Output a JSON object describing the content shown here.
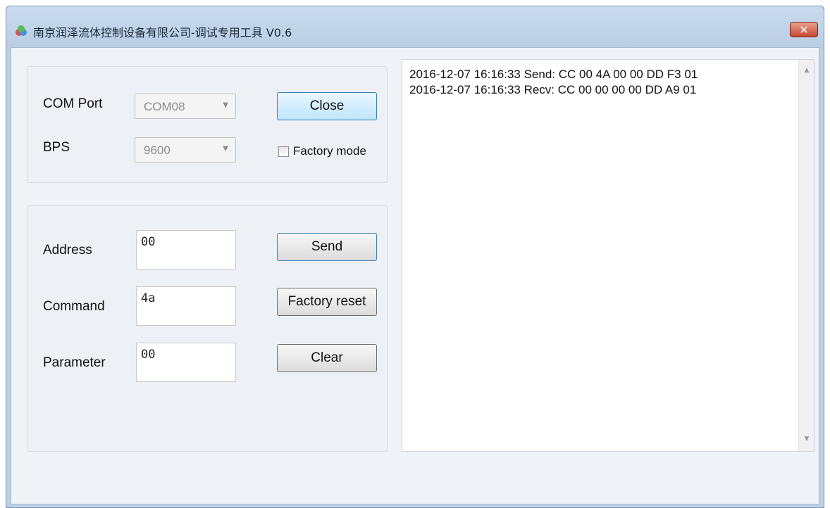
{
  "window": {
    "title": "南京润泽流体控制设备有限公司-调试专用工具 V0.6",
    "close_glyph": "✕"
  },
  "serial": {
    "com_port_label": "COM Port",
    "com_port_value": "COM08",
    "bps_label": "BPS",
    "bps_value": "9600",
    "close_label": "Close",
    "factory_mode_label": "Factory mode"
  },
  "command": {
    "address_label": "Address",
    "address_value": "00",
    "command_label": "Command",
    "command_value": "4a",
    "parameter_label": "Parameter",
    "parameter_value": "00",
    "send_label": "Send",
    "factory_reset_label": "Factory reset",
    "clear_label": "Clear"
  },
  "log": {
    "lines": [
      "2016-12-07 16:16:33 Send: CC 00 4A 00 00 DD F3 01",
      "2016-12-07 16:16:33 Recv: CC 00 00 00 00 DD A9 01"
    ]
  },
  "icons": {
    "app": "app-icon",
    "close": "close-icon",
    "dropdown": "chevron-down-icon",
    "scroll_up": "scroll-up-icon",
    "scroll_down": "scroll-down-icon"
  },
  "colors": {
    "titlebar": "#bcd0e6",
    "close_button": "#c8472f",
    "focused_button": "#bee6fd"
  }
}
